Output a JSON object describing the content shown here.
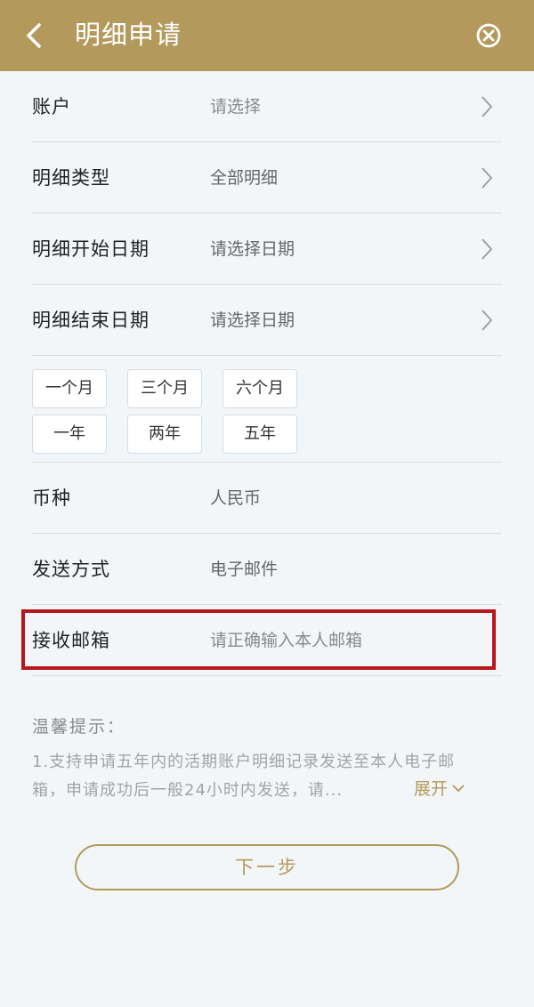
{
  "header": {
    "title": "明细申请",
    "back_icon": "chevron-left-icon",
    "close_icon": "close-circle-icon",
    "color": "#b39a5c"
  },
  "form": {
    "account": {
      "label": "账户",
      "value": "请选择"
    },
    "detail_type": {
      "label": "明细类型",
      "value": "全部明细"
    },
    "start_date": {
      "label": "明细开始日期",
      "value": "请选择日期"
    },
    "end_date": {
      "label": "明细结束日期",
      "value": "请选择日期"
    },
    "quick_ranges": [
      "一个月",
      "三个月",
      "六个月",
      "一年",
      "两年",
      "五年"
    ],
    "currency": {
      "label": "币种",
      "value": "人民币"
    },
    "send_method": {
      "label": "发送方式",
      "value": "电子邮件"
    },
    "email": {
      "label": "接收邮箱",
      "placeholder": "请正确输入本人邮箱"
    }
  },
  "tips": {
    "title": "温馨提示：",
    "line1": "1.支持申请五年内的活期账户明细记录发送至本人电子邮",
    "line2": "箱，申请成功后一般24小时内发送，请...",
    "expand_label": "展开"
  },
  "next_button": "下一步",
  "highlight_color": "#b8161c"
}
